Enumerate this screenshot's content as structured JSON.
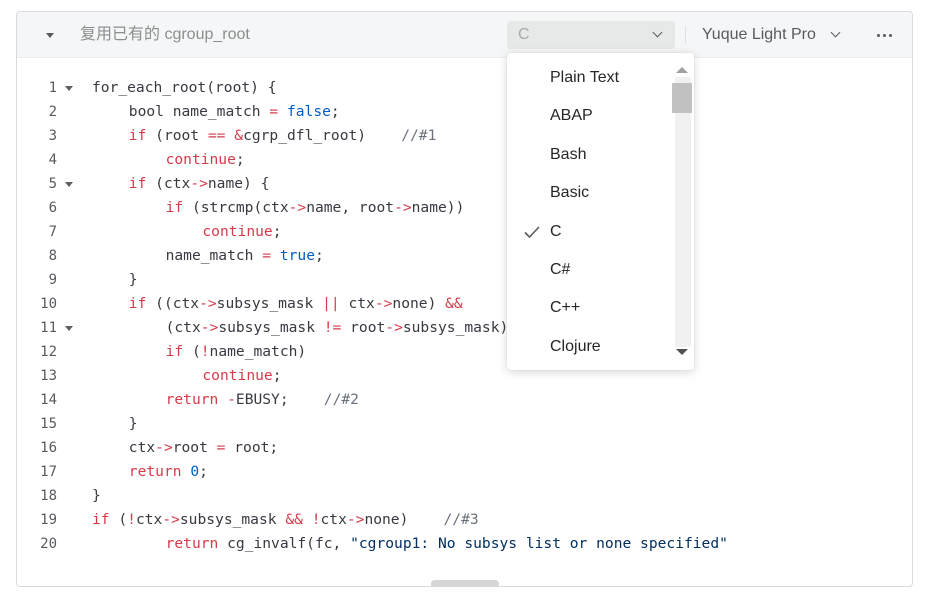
{
  "toolbar": {
    "title": "复用已有的 cgroup_root",
    "language_value": "C",
    "theme_value": "Yuque Light Pro"
  },
  "dropdown": {
    "items": [
      {
        "label": "Plain Text",
        "selected": false
      },
      {
        "label": "ABAP",
        "selected": false
      },
      {
        "label": "Bash",
        "selected": false
      },
      {
        "label": "Basic",
        "selected": false
      },
      {
        "label": "C",
        "selected": true
      },
      {
        "label": "C#",
        "selected": false
      },
      {
        "label": "C++",
        "selected": false
      },
      {
        "label": "Clojure",
        "selected": false
      }
    ]
  },
  "code": {
    "lines": [
      {
        "n": "1",
        "fold": true,
        "indent": 0,
        "tokens": [
          [
            "for_each_root(root) {",
            "plain"
          ]
        ]
      },
      {
        "n": "2",
        "fold": false,
        "indent": 1,
        "tokens": [
          [
            "bool name_match ",
            "plain"
          ],
          [
            "=",
            "op"
          ],
          [
            " ",
            "plain"
          ],
          [
            "false",
            "lit"
          ],
          [
            ";",
            "plain"
          ]
        ]
      },
      {
        "n": "3",
        "fold": false,
        "indent": 1,
        "tokens": [
          [
            "if",
            "kw"
          ],
          [
            " (root ",
            "plain"
          ],
          [
            "==",
            "op"
          ],
          [
            " ",
            "plain"
          ],
          [
            "&",
            "op"
          ],
          [
            "cgrp_dfl_root)    ",
            "plain"
          ],
          [
            "//#1",
            "cm"
          ]
        ]
      },
      {
        "n": "4",
        "fold": false,
        "indent": 2,
        "tokens": [
          [
            "continue",
            "kw"
          ],
          [
            ";",
            "plain"
          ]
        ]
      },
      {
        "n": "5",
        "fold": true,
        "indent": 1,
        "tokens": [
          [
            "if",
            "kw"
          ],
          [
            " (ctx",
            "plain"
          ],
          [
            "->",
            "op"
          ],
          [
            "name) {",
            "plain"
          ]
        ]
      },
      {
        "n": "6",
        "fold": false,
        "indent": 2,
        "tokens": [
          [
            "if",
            "kw"
          ],
          [
            " (strcmp(ctx",
            "plain"
          ],
          [
            "->",
            "op"
          ],
          [
            "name, root",
            "plain"
          ],
          [
            "->",
            "op"
          ],
          [
            "name))",
            "plain"
          ]
        ]
      },
      {
        "n": "7",
        "fold": false,
        "indent": 3,
        "tokens": [
          [
            "continue",
            "kw"
          ],
          [
            ";",
            "plain"
          ]
        ]
      },
      {
        "n": "8",
        "fold": false,
        "indent": 2,
        "tokens": [
          [
            "name_match ",
            "plain"
          ],
          [
            "=",
            "op"
          ],
          [
            " ",
            "plain"
          ],
          [
            "true",
            "lit"
          ],
          [
            ";",
            "plain"
          ]
        ]
      },
      {
        "n": "9",
        "fold": false,
        "indent": 1,
        "tokens": [
          [
            "}",
            "plain"
          ]
        ]
      },
      {
        "n": "10",
        "fold": false,
        "indent": 1,
        "tokens": [
          [
            "if",
            "kw"
          ],
          [
            " ((ctx",
            "plain"
          ],
          [
            "->",
            "op"
          ],
          [
            "subsys_mask ",
            "plain"
          ],
          [
            "||",
            "op"
          ],
          [
            " ctx",
            "plain"
          ],
          [
            "->",
            "op"
          ],
          [
            "none) ",
            "plain"
          ],
          [
            "&&",
            "op"
          ]
        ]
      },
      {
        "n": "11",
        "fold": true,
        "indent": 2,
        "tokens": [
          [
            "(ctx",
            "plain"
          ],
          [
            "->",
            "op"
          ],
          [
            "subsys_mask ",
            "plain"
          ],
          [
            "!=",
            "op"
          ],
          [
            " root",
            "plain"
          ],
          [
            "->",
            "op"
          ],
          [
            "subsys_mask)))",
            "plain"
          ]
        ]
      },
      {
        "n": "12",
        "fold": false,
        "indent": 2,
        "tokens": [
          [
            "if",
            "kw"
          ],
          [
            " (",
            "plain"
          ],
          [
            "!",
            "op"
          ],
          [
            "name_match)",
            "plain"
          ]
        ]
      },
      {
        "n": "13",
        "fold": false,
        "indent": 3,
        "tokens": [
          [
            "continue",
            "kw"
          ],
          [
            ";",
            "plain"
          ]
        ]
      },
      {
        "n": "14",
        "fold": false,
        "indent": 2,
        "tokens": [
          [
            "return",
            "kw"
          ],
          [
            " ",
            "plain"
          ],
          [
            "-",
            "op"
          ],
          [
            "EBUSY;    ",
            "plain"
          ],
          [
            "//#2",
            "cm"
          ]
        ]
      },
      {
        "n": "15",
        "fold": false,
        "indent": 1,
        "tokens": [
          [
            "}",
            "plain"
          ]
        ]
      },
      {
        "n": "16",
        "fold": false,
        "indent": 1,
        "tokens": [
          [
            "ctx",
            "plain"
          ],
          [
            "->",
            "op"
          ],
          [
            "root ",
            "plain"
          ],
          [
            "=",
            "op"
          ],
          [
            " root;",
            "plain"
          ]
        ]
      },
      {
        "n": "17",
        "fold": false,
        "indent": 1,
        "tokens": [
          [
            "return",
            "kw"
          ],
          [
            " ",
            "plain"
          ],
          [
            "0",
            "lit"
          ],
          [
            ";",
            "plain"
          ]
        ]
      },
      {
        "n": "18",
        "fold": false,
        "indent": 0,
        "tokens": [
          [
            "}",
            "plain"
          ]
        ]
      },
      {
        "n": "19",
        "fold": false,
        "indent": 0,
        "tokens": [
          [
            "if",
            "kw"
          ],
          [
            " (",
            "plain"
          ],
          [
            "!",
            "op"
          ],
          [
            "ctx",
            "plain"
          ],
          [
            "->",
            "op"
          ],
          [
            "subsys_mask ",
            "plain"
          ],
          [
            "&&",
            "op"
          ],
          [
            " ",
            "plain"
          ],
          [
            "!",
            "op"
          ],
          [
            "ctx",
            "plain"
          ],
          [
            "->",
            "op"
          ],
          [
            "none)    ",
            "plain"
          ],
          [
            "//#3",
            "cm"
          ]
        ]
      },
      {
        "n": "20",
        "fold": false,
        "indent": 2,
        "tokens": [
          [
            "return",
            "kw"
          ],
          [
            " cg_invalf(fc, ",
            "plain"
          ],
          [
            "\"cgroup1: No subsys list or none specified\"",
            "str"
          ]
        ]
      }
    ]
  }
}
